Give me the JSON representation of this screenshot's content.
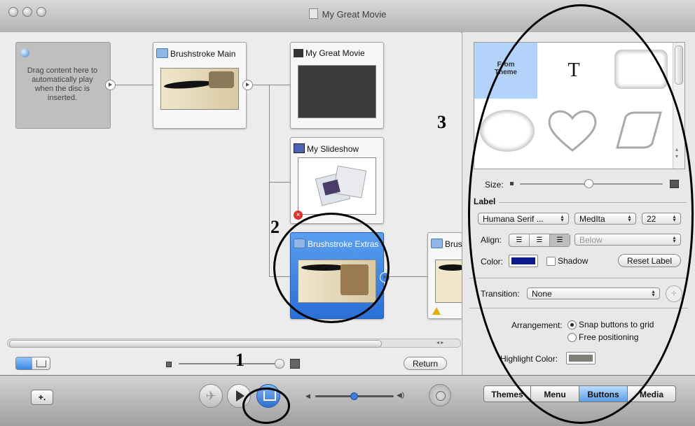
{
  "window": {
    "title": "My Great Movie"
  },
  "map": {
    "autoplay_text": "Drag content here to automatically play when the disc is inserted.",
    "nodes": {
      "brushstroke_main": "Brushstroke Main",
      "my_great_movie": "My Great Movie",
      "my_slideshow": "My Slideshow",
      "brushstroke_extras": "Brushstroke Extras",
      "brushstroke_partial": "Brus"
    },
    "return_label": "Return"
  },
  "panel": {
    "from_theme": "From Theme",
    "text_glyph": "T",
    "size_label": "Size:",
    "section_label": "Label",
    "font_family": "Humana Serif ...",
    "font_style": "MedIta",
    "font_size": "22",
    "align_label": "Align:",
    "position_value": "Below",
    "color_label": "Color:",
    "label_color": "#0d1a8c",
    "shadow_label": "Shadow",
    "reset_label": "Reset Label",
    "transition_label": "Transition:",
    "transition_value": "None",
    "arrangement_label": "Arrangement:",
    "arrangement_options": [
      "Snap buttons to grid",
      "Free positioning"
    ],
    "arrangement_selected": "Snap buttons to grid",
    "highlight_label": "Highlight Color:",
    "highlight_color": "#7f7f78"
  },
  "toolbar": {
    "add_label": "+.",
    "tabs": [
      "Themes",
      "Menu",
      "Buttons",
      "Media"
    ],
    "selected_tab": "Buttons"
  },
  "annotations": {
    "a1": "1",
    "a2": "2",
    "a3": "3"
  }
}
